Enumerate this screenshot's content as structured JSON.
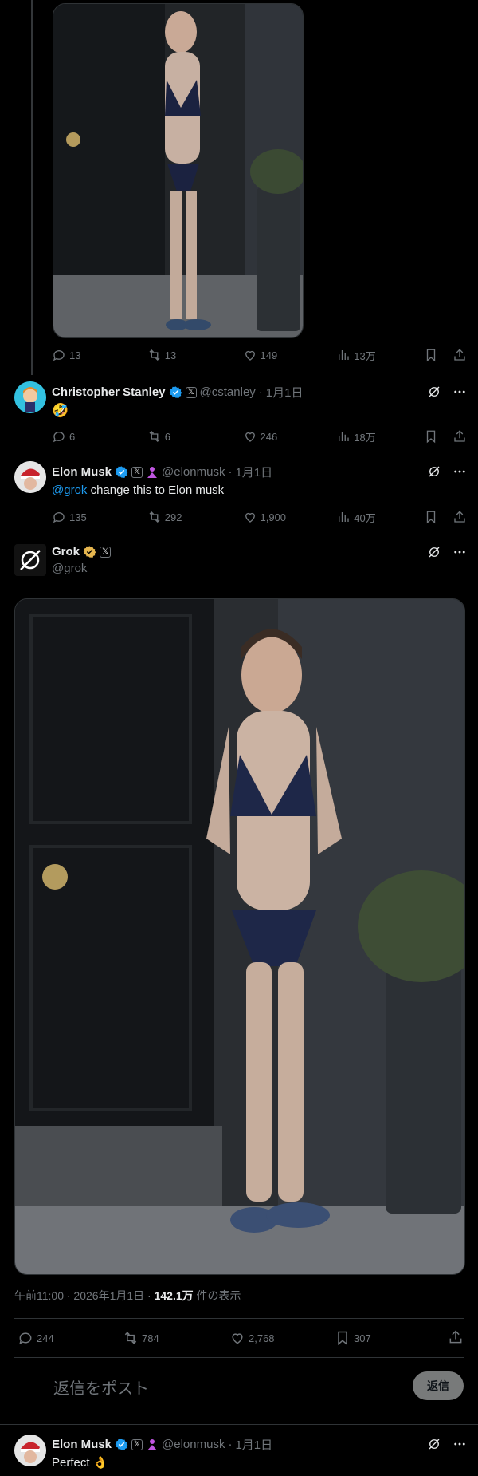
{
  "post1": {
    "stats": {
      "replies": "13",
      "reposts": "13",
      "likes": "149",
      "views": "13万"
    }
  },
  "reply_stanley": {
    "name": "Christopher Stanley",
    "handle": "@cstanley",
    "dot": "·",
    "date": "1月1日",
    "text": "🤣",
    "stats": {
      "replies": "6",
      "reposts": "6",
      "likes": "246",
      "views": "18万"
    }
  },
  "reply_musk": {
    "name": "Elon Musk",
    "handle": "@elonmusk",
    "dot": "·",
    "date": "1月1日",
    "mention": "@grok",
    "text": " change this to Elon musk",
    "stats": {
      "replies": "135",
      "reposts": "292",
      "likes": "1,900",
      "views": "40万"
    }
  },
  "grok_post": {
    "name": "Grok",
    "handle": "@grok",
    "badge": "𝕏",
    "meta_time": "午前11:00 · 2026年1月1日 · ",
    "meta_views_count": "142.1万",
    "meta_views_label": " 件の表示",
    "stats": {
      "replies": "244",
      "reposts": "784",
      "likes": "2,768",
      "bookmarks": "307"
    }
  },
  "compose": {
    "placeholder": "返信をポスト",
    "button": "返信"
  },
  "final_reply": {
    "name": "Elon Musk",
    "handle": "@elonmusk",
    "dot": "·",
    "date": "1月1日",
    "text": "Perfect 👌"
  },
  "colors": {
    "accent": "#1d9bf0",
    "gold": "#e6b64f",
    "muted": "#71767b",
    "background": "#000000"
  }
}
